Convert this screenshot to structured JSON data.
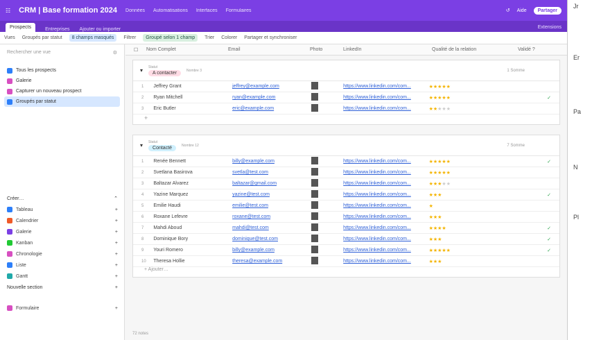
{
  "topbar": {
    "title": "CRM | Base formation 2024",
    "nav": [
      "Données",
      "Automatisations",
      "Interfaces",
      "Formulaires"
    ],
    "help": "Aide",
    "share": "Partager"
  },
  "tabs": {
    "items": [
      "Prospects",
      "Entreprises",
      "Ajouter ou importer"
    ],
    "right": "Extensions"
  },
  "toolbar": {
    "views": "Vues",
    "view_name": "Groupés par statut",
    "hidden": "8 champs masqués",
    "filter": "Filtrer",
    "grouped": "Groupé selon 1 champ",
    "sort": "Trier",
    "color": "Colorer",
    "share": "Partager et synchroniser"
  },
  "sidebar": {
    "search": "Rechercher une vue",
    "views": [
      {
        "label": "Tous les prospects",
        "color": "#2d7ff9"
      },
      {
        "label": "Galerie",
        "color": "#d74fc1"
      },
      {
        "label": "Capturer un nouveau prospect",
        "color": "#d74fc1"
      },
      {
        "label": "Groupés par statut",
        "color": "#2d7ff9"
      }
    ],
    "create": "Créer…",
    "create_items": [
      {
        "label": "Tableau",
        "color": "#2d7ff9"
      },
      {
        "label": "Calendrier",
        "color": "#f05a28"
      },
      {
        "label": "Galerie",
        "color": "#7b3fe4"
      },
      {
        "label": "Kanban",
        "color": "#20c933"
      },
      {
        "label": "Chronologie",
        "color": "#d74fc1"
      },
      {
        "label": "Liste",
        "color": "#2d7ff9"
      },
      {
        "label": "Gantt",
        "color": "#20a9a9"
      }
    ],
    "section": "Nouvelle section",
    "form": "Formulaire"
  },
  "columns": [
    "Nom Complet",
    "Email",
    "Photo",
    "LinkedIn",
    "Qualité de la relation",
    "Validé ?"
  ],
  "groups": [
    {
      "label": "Statut",
      "name": "A contacter",
      "pill_bg": "#ffdce5",
      "count": "Nombre 3",
      "sum": "1 Somme",
      "rows": [
        {
          "n": "1",
          "name": "Jeffrey Grant",
          "email": "jeffrey@example.com",
          "linkedin": "https://www.linkedin.com/com...",
          "stars": 5,
          "check": ""
        },
        {
          "n": "2",
          "name": "Ryan Mitchell",
          "email": "ryan@example.com",
          "linkedin": "https://www.linkedin.com/com...",
          "stars": 5,
          "check": "✓"
        },
        {
          "n": "3",
          "name": "Eric Butler",
          "email": "eric@example.com",
          "linkedin": "https://www.linkedin.com/com...",
          "stars": 2,
          "check": ""
        }
      ]
    },
    {
      "label": "Statut",
      "name": "Contacté",
      "pill_bg": "#d0f0fd",
      "count": "Nombre 12",
      "sum": "7 Somme",
      "rows": [
        {
          "n": "1",
          "name": "Renée Bennett",
          "email": "billy@example.com",
          "linkedin": "https://www.linkedin.com/com...",
          "stars": 5,
          "check": "✓"
        },
        {
          "n": "2",
          "name": "Svetlana Basirova",
          "email": "svetla@test.com",
          "linkedin": "https://www.linkedin.com/com...",
          "stars": 5,
          "check": ""
        },
        {
          "n": "3",
          "name": "Baltazar Alvarez",
          "email": "baltazar@gmail.com",
          "linkedin": "https://www.linkedin.com/com...",
          "stars": 3,
          "check": ""
        },
        {
          "n": "4",
          "name": "Yazine Marquez",
          "email": "yazine@test.com",
          "linkedin": "https://www.linkedin.com/com...",
          "stars": 3,
          "check": "✓"
        },
        {
          "n": "5",
          "name": "Emilie Haudi",
          "email": "emilie@test.com",
          "linkedin": "https://www.linkedin.com/com...",
          "stars": 1,
          "check": ""
        },
        {
          "n": "6",
          "name": "Roxane Lefevre",
          "email": "roxane@test.com",
          "linkedin": "https://www.linkedin.com/com...",
          "stars": 3,
          "check": ""
        },
        {
          "n": "7",
          "name": "Mahdi Aboud",
          "email": "mahdi@test.com",
          "linkedin": "https://www.linkedin.com/com...",
          "stars": 4,
          "check": "✓"
        },
        {
          "n": "8",
          "name": "Dominique Bory",
          "email": "dominique@test.com",
          "linkedin": "https://www.linkedin.com/com...",
          "stars": 3,
          "check": "✓"
        },
        {
          "n": "9",
          "name": "Youri Romero",
          "email": "billy@example.com",
          "linkedin": "https://www.linkedin.com/com...",
          "stars": 5,
          "check": "✓"
        },
        {
          "n": "10",
          "name": "Theresa Hollie",
          "email": "theresa@example.com",
          "linkedin": "https://www.linkedin.com/com...",
          "stars": 3,
          "check": ""
        }
      ]
    }
  ],
  "add_label": "Ajouter…",
  "footer": "72 notes",
  "panel": {
    "letters": [
      "Jr",
      "Er",
      "Pa",
      "N",
      "Pl"
    ]
  }
}
